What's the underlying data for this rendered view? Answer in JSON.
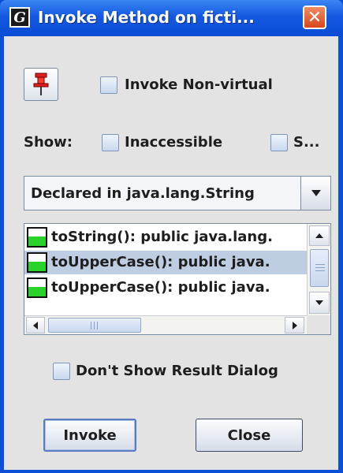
{
  "window": {
    "title": "Invoke Method on ficti...",
    "app_icon_letter": "G",
    "close_glyph": "✕"
  },
  "options": {
    "pin_icon": "pin-icon",
    "invoke_nonvirtual_label": "Invoke Non-virtual",
    "invoke_nonvirtual_checked": false,
    "show_label": "Show:",
    "inaccessible_label": "Inaccessible",
    "inaccessible_checked": false,
    "static_label": "S...",
    "static_checked": false
  },
  "filter": {
    "selected": "Declared in java.lang.String"
  },
  "methods": {
    "items": [
      {
        "label": "toString():  public java.lang.",
        "selected": false
      },
      {
        "label": "toUpperCase():  public java.",
        "selected": true
      },
      {
        "label": "toUpperCase():  public java.",
        "selected": false
      }
    ],
    "item_icon_color": "#29d12b",
    "selection_color": "#bfcde3"
  },
  "dont_show_result": {
    "label": "Don't Show Result Dialog",
    "checked": false
  },
  "buttons": {
    "invoke_label": "Invoke",
    "close_label": "Close"
  },
  "colors": {
    "titlebar": "#0a4fd6",
    "close_button": "#d9461c",
    "dialog_bg": "#e3e3e3"
  }
}
